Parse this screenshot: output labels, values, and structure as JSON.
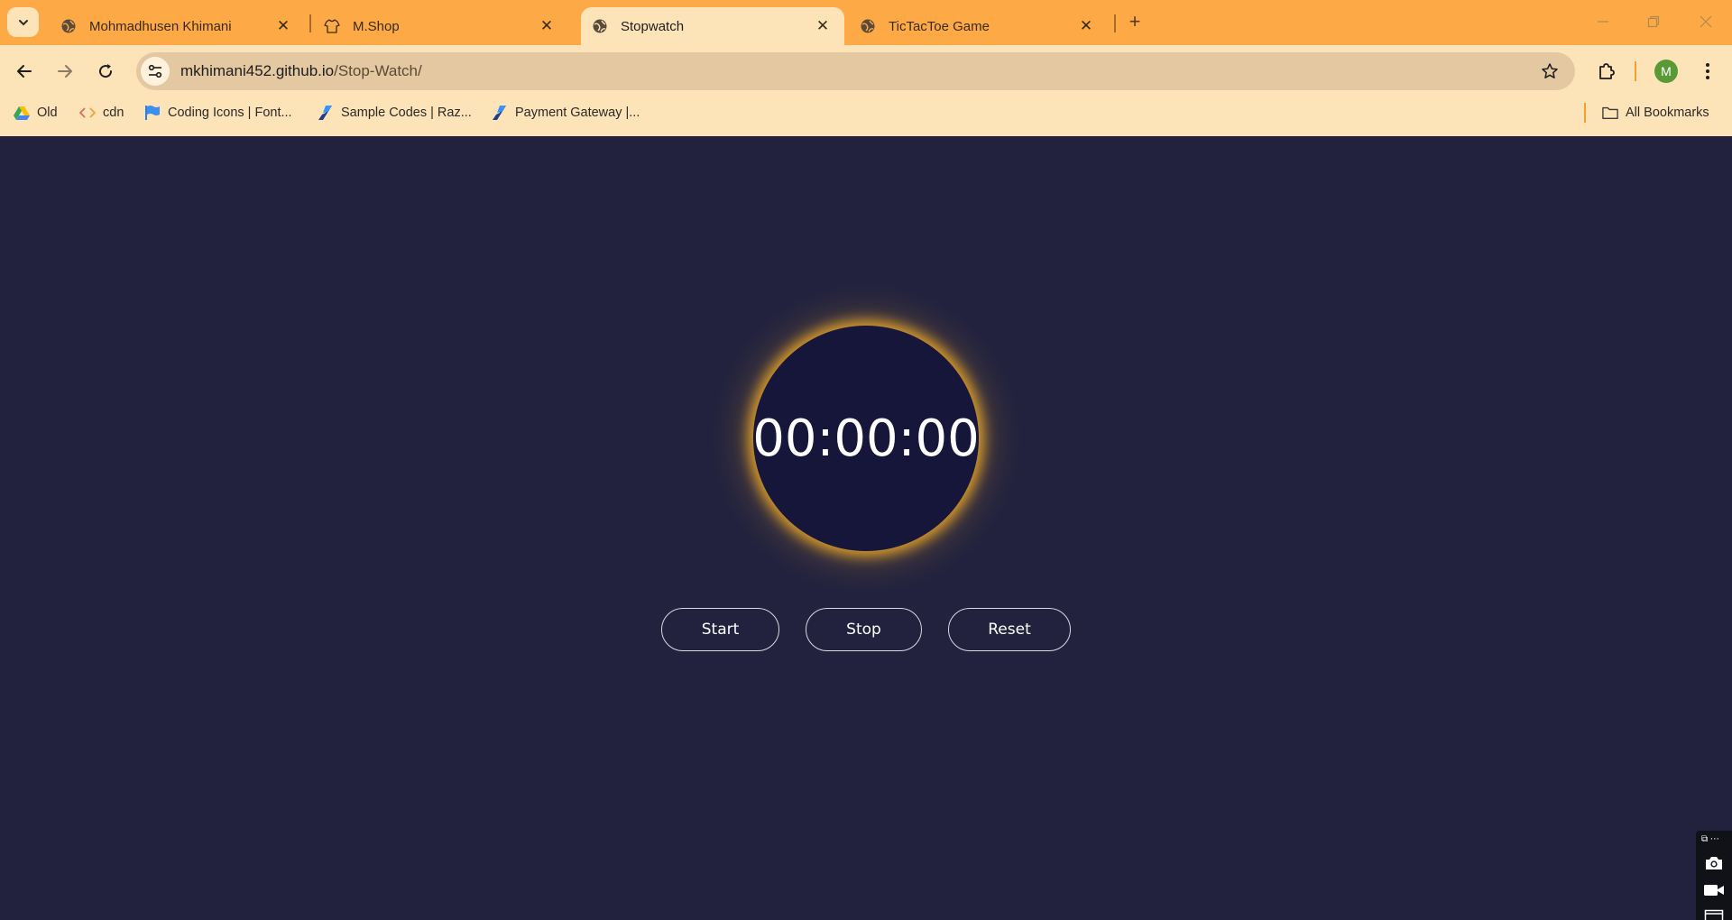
{
  "tabs": [
    {
      "title": "Mohmadhusen Khimani",
      "icon": "globe-icon",
      "active": false
    },
    {
      "title": "M.Shop",
      "icon": "shirt-icon",
      "active": false
    },
    {
      "title": "Stopwatch",
      "icon": "globe-icon",
      "active": true
    },
    {
      "title": "TicTacToe Game",
      "icon": "globe-icon",
      "active": false
    }
  ],
  "address_bar": {
    "domain": "mkhimani452.github.io",
    "path": "/Stop-Watch/"
  },
  "profile": {
    "initial": "M",
    "color": "#5a9a36"
  },
  "bookmarks": [
    {
      "label": "Old",
      "icon": "drive-icon"
    },
    {
      "label": "cdn",
      "icon": "code-icon"
    },
    {
      "label": "Coding Icons | Font...",
      "icon": "flag-icon"
    },
    {
      "label": "Sample Codes | Raz...",
      "icon": "razorpay-icon"
    },
    {
      "label": "Payment Gateway |...",
      "icon": "razorpay-icon"
    }
  ],
  "all_bookmarks_label": "All Bookmarks",
  "stopwatch": {
    "time": "00:00:00",
    "buttons": {
      "start": "Start",
      "stop": "Stop",
      "reset": "Reset"
    }
  },
  "colors": {
    "tabstrip": "#fdaa46",
    "toolbar": "#fde3b8",
    "page_background": "#22223f",
    "clock_face": "#16163a",
    "clock_glow": "#f0aa28"
  }
}
